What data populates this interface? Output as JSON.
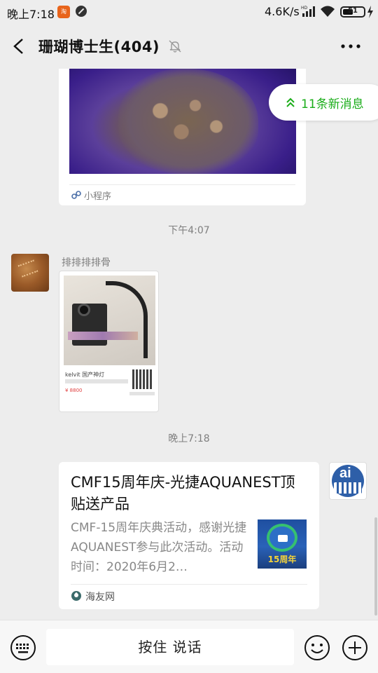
{
  "status_bar": {
    "time": "晚上7:18",
    "app_badge_icon": "taobao-icon",
    "block_icon": "no-disturb-icon",
    "net_speed": "4.6K/s",
    "battery_level": "51"
  },
  "header": {
    "title": "珊瑚博士生(404)",
    "back_icon": "back-arrow-icon",
    "mute_icon": "muted-bell-icon",
    "more_icon": "more-dots-icon"
  },
  "new_messages": {
    "label": "11条新消息",
    "icon": "double-chevron-up-icon"
  },
  "messages": {
    "mini_program": {
      "source_label": "小程序",
      "icon": "mini-program-icon"
    },
    "timestamp_1": "下午4:07",
    "image_message": {
      "sender": "排排排排骨",
      "product_title": "kelvit 国产神灯",
      "price": "¥ 8800"
    },
    "timestamp_2": "晚上7:18",
    "link_card": {
      "title": "CMF15周年庆-光捷AQUANEST顶贴送产品",
      "description": "CMF-15周年庆典活动，感谢光捷AQUANEST参与此次活动。活动时间：2020年6月2…",
      "thumb_text": "15周年",
      "source": "海友网"
    }
  },
  "input_bar": {
    "hold_to_talk": "按住 说话",
    "keyboard_icon": "keyboard-icon",
    "emoji_icon": "emoji-icon",
    "plus_icon": "plus-icon"
  },
  "colors": {
    "background": "#ededed",
    "accent_green": "#1aad19",
    "card": "#ffffff",
    "muted_text": "#7f7f7f"
  }
}
